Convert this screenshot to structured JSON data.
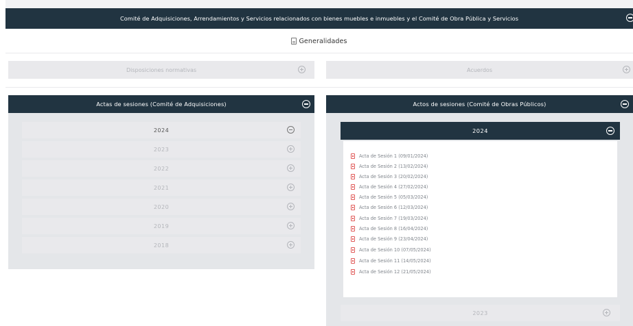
{
  "header": {
    "title": "Comité de Adquisiciones, Arrendamientos y Servicios relacionados con bienes muebles e inmuebles y el Comité de Obra Pública y Servicios"
  },
  "generalidades": {
    "label": "Generalidades",
    "icon": "document-icon"
  },
  "sections": {
    "disposiciones": {
      "label": "Disposiciones normativas"
    },
    "acuerdos": {
      "label": "Acuerdos"
    }
  },
  "panel_left": {
    "title": "Actas de sesiones (Comité de Adquisiciones)",
    "years": [
      {
        "label": "2024",
        "expanded": true
      },
      {
        "label": "2023",
        "expanded": false
      },
      {
        "label": "2022",
        "expanded": false
      },
      {
        "label": "2021",
        "expanded": false
      },
      {
        "label": "2020",
        "expanded": false
      },
      {
        "label": "2019",
        "expanded": false
      },
      {
        "label": "2018",
        "expanded": false
      }
    ]
  },
  "panel_right": {
    "title": "Actos de sesiones (Comité de Obras Públicos)",
    "active_year": "2024",
    "acts": [
      "Acta de Sesión 1 (09/01/2024)",
      "Acta de Sesión 2 (13/02/2024)",
      "Acta de Sesión 3 (20/02/2024)",
      "Acta de Sesión 4 (27/02/2024)",
      "Acta de Sesión 5 (05/03/2024)",
      "Acta de Sesión 6 (12/03/2024)",
      "Acta de Sesión 7 (19/03/2024)",
      "Acta de Sesión 8 (16/04/2024)",
      "Acta de Sesión 9 (23/04/2024)",
      "Acta de Sesión 10 (07/05/2024)",
      "Acta de Sesión 11 (14/05/2024)",
      "Acta de Sesión 12 (21/05/2024)"
    ],
    "next_year": "2023"
  },
  "colors": {
    "header_bg": "#213441",
    "collapsed_bg": "#e9e9ec",
    "panel_body_bg": "#e4e6e9",
    "pdf_icon": "#e05a58"
  }
}
